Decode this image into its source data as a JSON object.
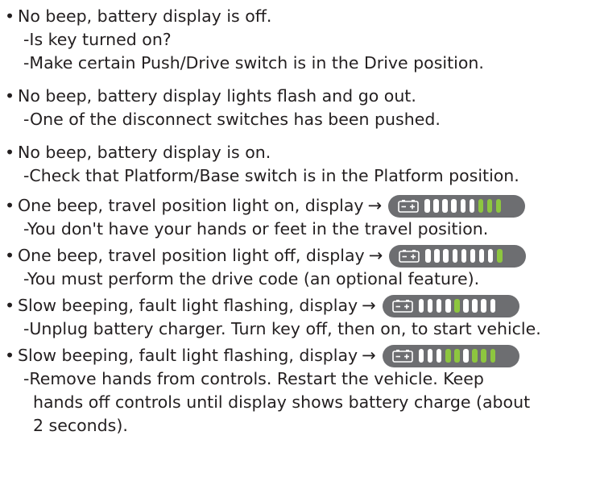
{
  "colors": {
    "text": "#231f20",
    "display_bg": "#6d6e71",
    "segment_off": "#ffffff",
    "segment_on": "#8dc63f"
  },
  "bullet_char": "•",
  "arrow": "→",
  "items": [
    {
      "bullet": "No beep, battery display is off.",
      "display": null,
      "subs": [
        "-Is key turned on?",
        "-Make certain Push/Drive switch is in the Drive position."
      ]
    },
    {
      "bullet": "No beep, battery display lights flash and go out.",
      "display": null,
      "subs": [
        "-One of the disconnect switches has been pushed."
      ]
    },
    {
      "bullet": "No beep, battery display is on.",
      "display": null,
      "subs": [
        "-Check that Platform/Base switch is in the Platform position."
      ]
    },
    {
      "bullet": "One beep, travel position light on, display",
      "display": [
        0,
        0,
        0,
        0,
        0,
        0,
        1,
        1,
        1
      ],
      "subs": [
        "-You don't have your hands or feet in the travel position."
      ]
    },
    {
      "bullet": "One beep, travel position light off, display",
      "display": [
        0,
        0,
        0,
        0,
        0,
        0,
        0,
        0,
        1
      ],
      "subs": [
        "-You must perform the drive code (an optional feature)."
      ]
    },
    {
      "bullet": "Slow beeping, fault light flashing, display",
      "display": [
        0,
        0,
        0,
        0,
        1,
        0,
        0,
        0,
        0
      ],
      "subs": [
        "-Unplug battery charger. Turn key off, then on, to start vehicle."
      ]
    },
    {
      "bullet": "Slow beeping, fault light flashing, display",
      "display": [
        0,
        0,
        0,
        1,
        1,
        0,
        1,
        1,
        1
      ],
      "subs": [
        "-Remove hands from controls. Restart the vehicle. Keep",
        "hands off controls until display shows battery charge (about",
        "2 seconds)."
      ]
    }
  ]
}
